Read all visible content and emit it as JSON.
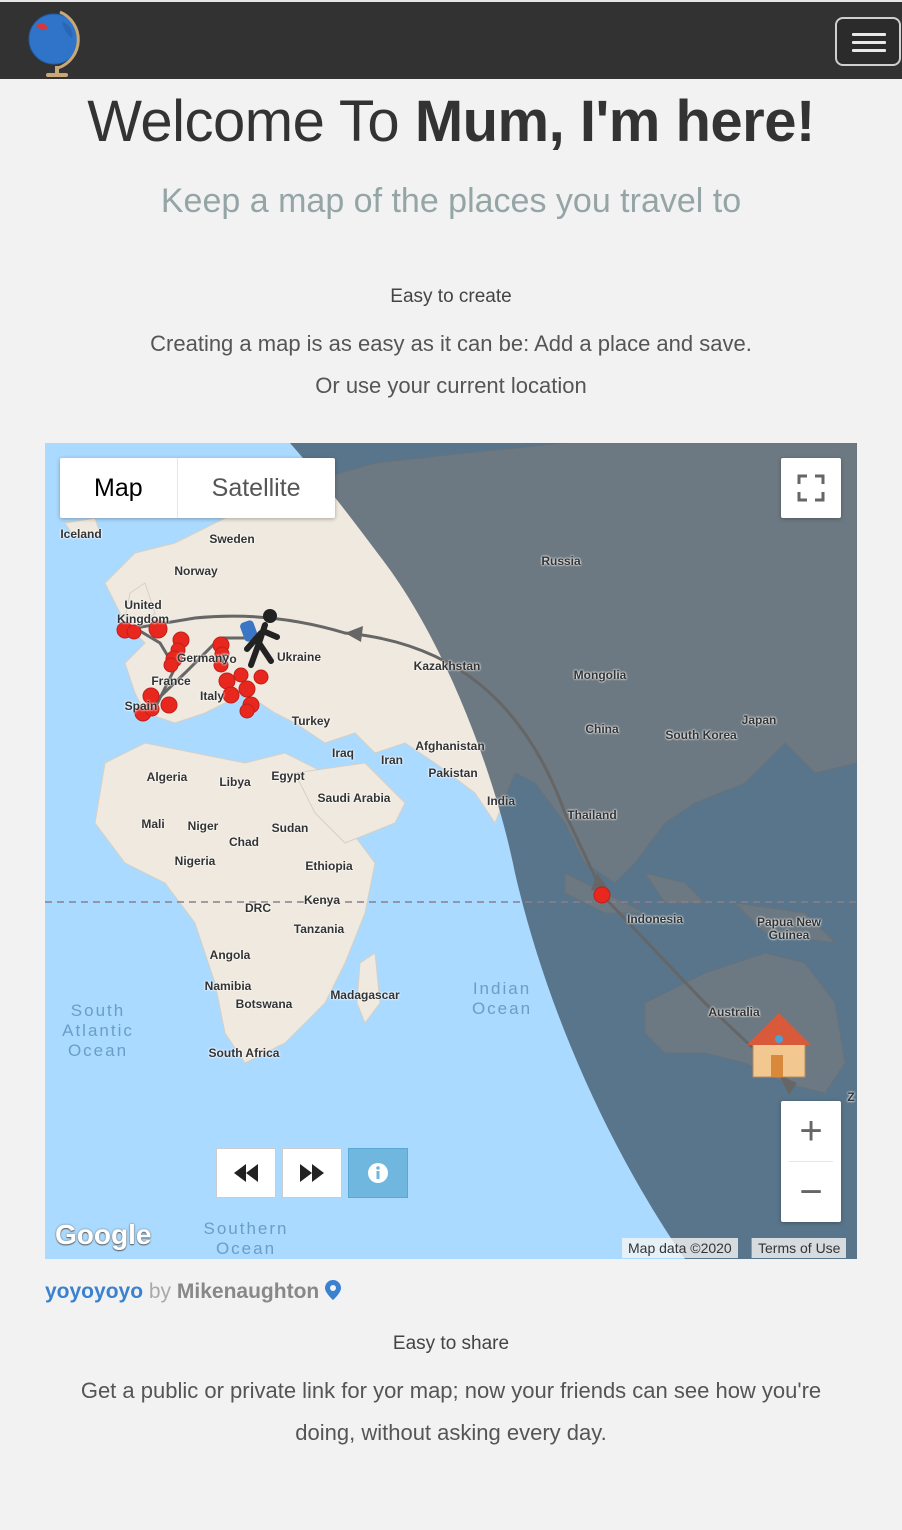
{
  "header": {
    "menu_icon": "hamburger-menu-icon",
    "logo_icon": "globe-logo-icon"
  },
  "hero": {
    "title_prefix": "Welcome To ",
    "title_brand": "Mum, I'm here!",
    "subtitle": "Keep a map of the places you travel to"
  },
  "feature_create": {
    "title": "Easy to create",
    "line1": "Creating a map is as easy as it can be: Add a place and save.",
    "line2": "Or use your current location"
  },
  "map": {
    "type_map": "Map",
    "type_satellite": "Satellite",
    "attribution": "Map data ©2020",
    "terms": "Terms of Use",
    "google": "Google",
    "zoom_in": "+",
    "zoom_out": "−",
    "labels": {
      "iceland": "Iceland",
      "sweden": "Sweden",
      "norway": "Norway",
      "uk": "United\nKingdom",
      "russia": "Russia",
      "ukraine": "Ukraine",
      "kazakhstan": "Kazakhstan",
      "mongolia": "Mongolia",
      "germany": "Germany",
      "france": "France",
      "spain": "Spain",
      "italy": "Italy",
      "poland": "Po",
      "turkey": "Turkey",
      "japan": "Japan",
      "china": "China",
      "south_korea": "South Korea",
      "iraq": "Iraq",
      "iran": "Iran",
      "afghanistan": "Afghanistan",
      "pakistan": "Pakistan",
      "algeria": "Algeria",
      "libya": "Libya",
      "egypt": "Egypt",
      "saudi": "Saudi Arabia",
      "india": "India",
      "thailand": "Thailand",
      "mali": "Mali",
      "niger": "Niger",
      "chad": "Chad",
      "sudan": "Sudan",
      "nigeria": "Nigeria",
      "ethiopia": "Ethiopia",
      "kenya": "Kenya",
      "drc": "DRC",
      "tanzania": "Tanzania",
      "indonesia": "Indonesia",
      "png": "Papua New\nGuinea",
      "angola": "Angola",
      "namibia": "Namibia",
      "botswana": "Botswana",
      "madagascar": "Madagascar",
      "australia": "Australia",
      "south_africa": "South Africa",
      "z": "Z",
      "south_atlantic": "South\nAtlantic\nOcean",
      "indian_ocean": "Indian\nOcean",
      "southern_ocean": "Southern\nOcean"
    }
  },
  "map_meta": {
    "name": "yoyoyoyo",
    "by": "by",
    "author": "Mikenaughton",
    "pin_icon": "map-pin-icon"
  },
  "feature_share": {
    "title": "Easy to share",
    "text": "Get a public or private link for yor map; now your friends can see how you're doing, without asking every day."
  },
  "colors": {
    "navbar": "#323232",
    "accent": "#3a82cf",
    "marker": "#e8281e",
    "subtitle": "#95a5a6"
  }
}
